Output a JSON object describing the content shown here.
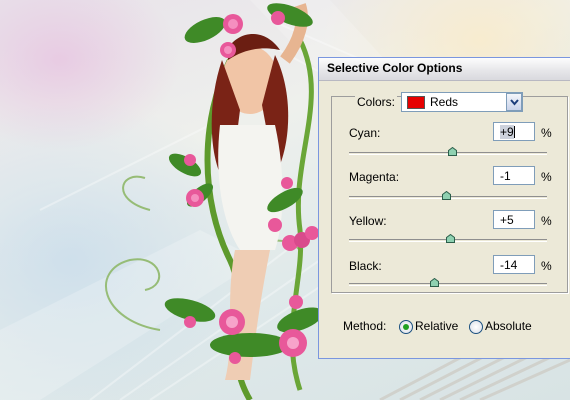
{
  "dialog": {
    "title": "Selective Color Options",
    "colors_label": "Colors:",
    "colors_value": "Reds",
    "colors_swatch": "#e60000",
    "sliders": [
      {
        "label": "Cyan:",
        "value": "+9",
        "unit": "%",
        "level": 0.52
      },
      {
        "label": "Magenta:",
        "value": "-1",
        "unit": "%",
        "level": 0.49
      },
      {
        "label": "Yellow:",
        "value": "+5",
        "unit": "%",
        "level": 0.51
      },
      {
        "label": "Black:",
        "value": "-14",
        "unit": "%",
        "level": 0.43
      }
    ],
    "method_label": "Method:",
    "method_options": [
      {
        "label": "Relative",
        "selected": true
      },
      {
        "label": "Absolute",
        "selected": false
      }
    ]
  },
  "icons": {
    "dropdown": "chevron-down-icon",
    "slider_thumb": "slider-thumb-icon"
  },
  "colors": {
    "dialog_bg": "#ece9d8",
    "dialog_border": "#7a96df",
    "radio_selected": "#21a121"
  }
}
